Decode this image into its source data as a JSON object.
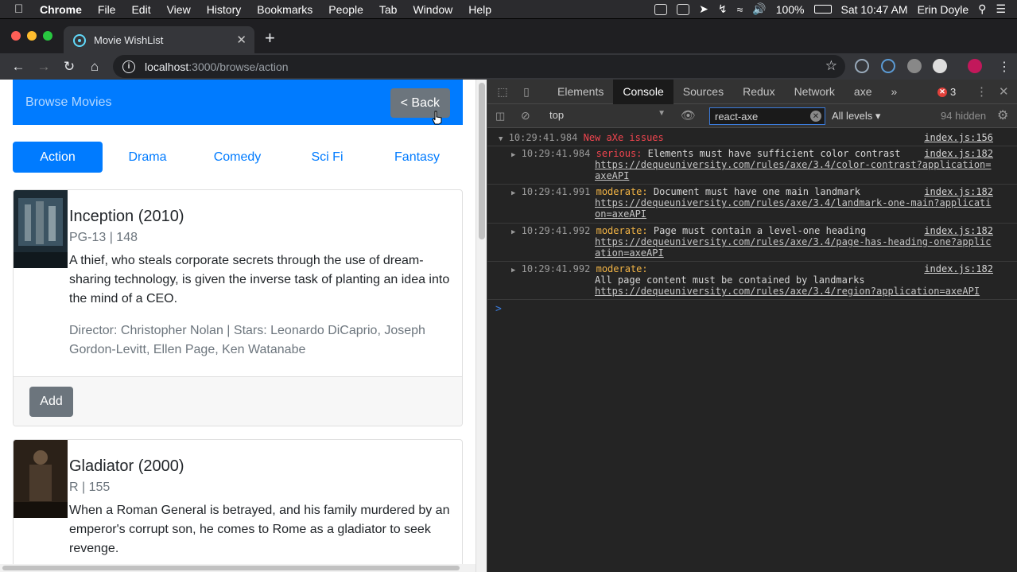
{
  "menubar": {
    "app": "Chrome",
    "items": [
      "File",
      "Edit",
      "View",
      "History",
      "Bookmarks",
      "People",
      "Tab",
      "Window",
      "Help"
    ],
    "battery": "100%",
    "clock": "Sat 10:47 AM",
    "user": "Erin Doyle"
  },
  "browser": {
    "tab_title": "Movie WishList",
    "url_host": "localhost",
    "url_path": ":3000/browse/action"
  },
  "page": {
    "brand": "Browse Movies",
    "back_label": "< Back",
    "genres": [
      "Action",
      "Drama",
      "Comedy",
      "Sci Fi",
      "Fantasy"
    ],
    "active_genre": "Action",
    "movies": [
      {
        "title": "Inception (2010)",
        "meta": "PG-13 | 148",
        "plot": "A thief, who steals corporate secrets through the use of dream-sharing technology, is given the inverse task of planting an idea into the mind of a CEO.",
        "credits": "Director: Christopher Nolan | Stars: Leonardo DiCaprio, Joseph Gordon-Levitt, Ellen Page, Ken Watanabe",
        "add_label": "Add"
      },
      {
        "title": "Gladiator (2000)",
        "meta": "R | 155",
        "plot": "When a Roman General is betrayed, and his family murdered by an emperor's corrupt son, he comes to Rome as a gladiator to seek revenge."
      }
    ]
  },
  "devtools": {
    "tabs": [
      "Elements",
      "Console",
      "Sources",
      "Redux",
      "Network",
      "axe"
    ],
    "active_tab": "Console",
    "more": "»",
    "error_count": "3",
    "context": "top",
    "filter": "react-axe",
    "levels": "All levels",
    "hidden": "94 hidden",
    "group": {
      "time": "10:29:41.984",
      "title": "New aXe issues",
      "source": "index.js:156"
    },
    "entries": [
      {
        "time": "10:29:41.984",
        "level": "serious:",
        "text": "Elements must have sufficient color contrast",
        "link1": "https://dequeuniversity.com/rules/axe/3.4/color-contrast?application=",
        "link2": "axeAPI",
        "source": "index.js:182"
      },
      {
        "time": "10:29:41.991",
        "level": "moderate:",
        "text": "Document must have one main landmark",
        "link1": "https://dequeuniversity.com/rules/axe/3.4/landmark-one-main?applicati",
        "link2": "on=axeAPI",
        "source": "index.js:182"
      },
      {
        "time": "10:29:41.992",
        "level": "moderate:",
        "text": "Page must contain a level-one heading",
        "link1": "https://dequeuniversity.com/rules/axe/3.4/page-has-heading-one?applic",
        "link2": "ation=axeAPI",
        "source": "index.js:182"
      },
      {
        "time": "10:29:41.992",
        "level": "moderate:",
        "text": "All page content must be contained by landmarks",
        "link1": "https://dequeuniversity.com/rules/axe/3.4/region?application=axeAPI",
        "link2": "",
        "source": "index.js:182"
      }
    ],
    "prompt": ">"
  },
  "colors": {
    "primary": "#007bff",
    "secondary": "#6c757d",
    "serious": "#f2454f",
    "moderate": "#f2b445"
  }
}
